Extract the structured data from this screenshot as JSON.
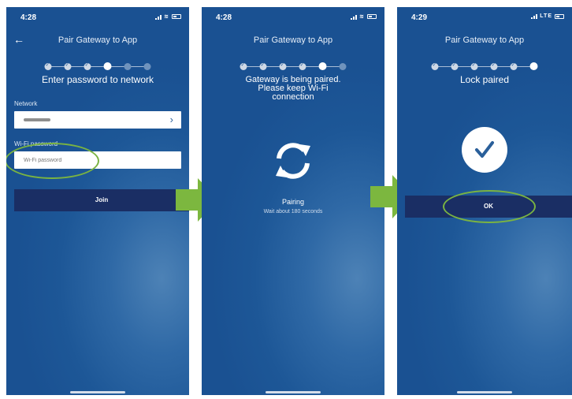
{
  "colors": {
    "screen_bg": "#1d5797",
    "button_bg": "#1a2e64",
    "highlight": "#7ab342",
    "arrow": "#7cb73f"
  },
  "screen1": {
    "time": "4:28",
    "title": "Pair Gateway to App",
    "back_icon": "arrow-left-icon",
    "heading": "Enter password to network",
    "network_label": "Network",
    "password_label": "Wi-Fi password",
    "password_placeholder": "Wi-Fi password",
    "join_label": "Join"
  },
  "screen2": {
    "time": "4:28",
    "title": "Pair Gateway to App",
    "heading_lines": [
      "Gateway is being paired.",
      "Please keep Wi-Fi",
      "connection"
    ],
    "sync_icon": "sync-icon",
    "status": "Pairing",
    "wait": "Wait about 180 seconds"
  },
  "screen3": {
    "time": "4:29",
    "title": "Pair Gateway to App",
    "network": "LTE",
    "heading": "Lock paired",
    "check_icon": "check-icon",
    "ok_label": "OK"
  }
}
